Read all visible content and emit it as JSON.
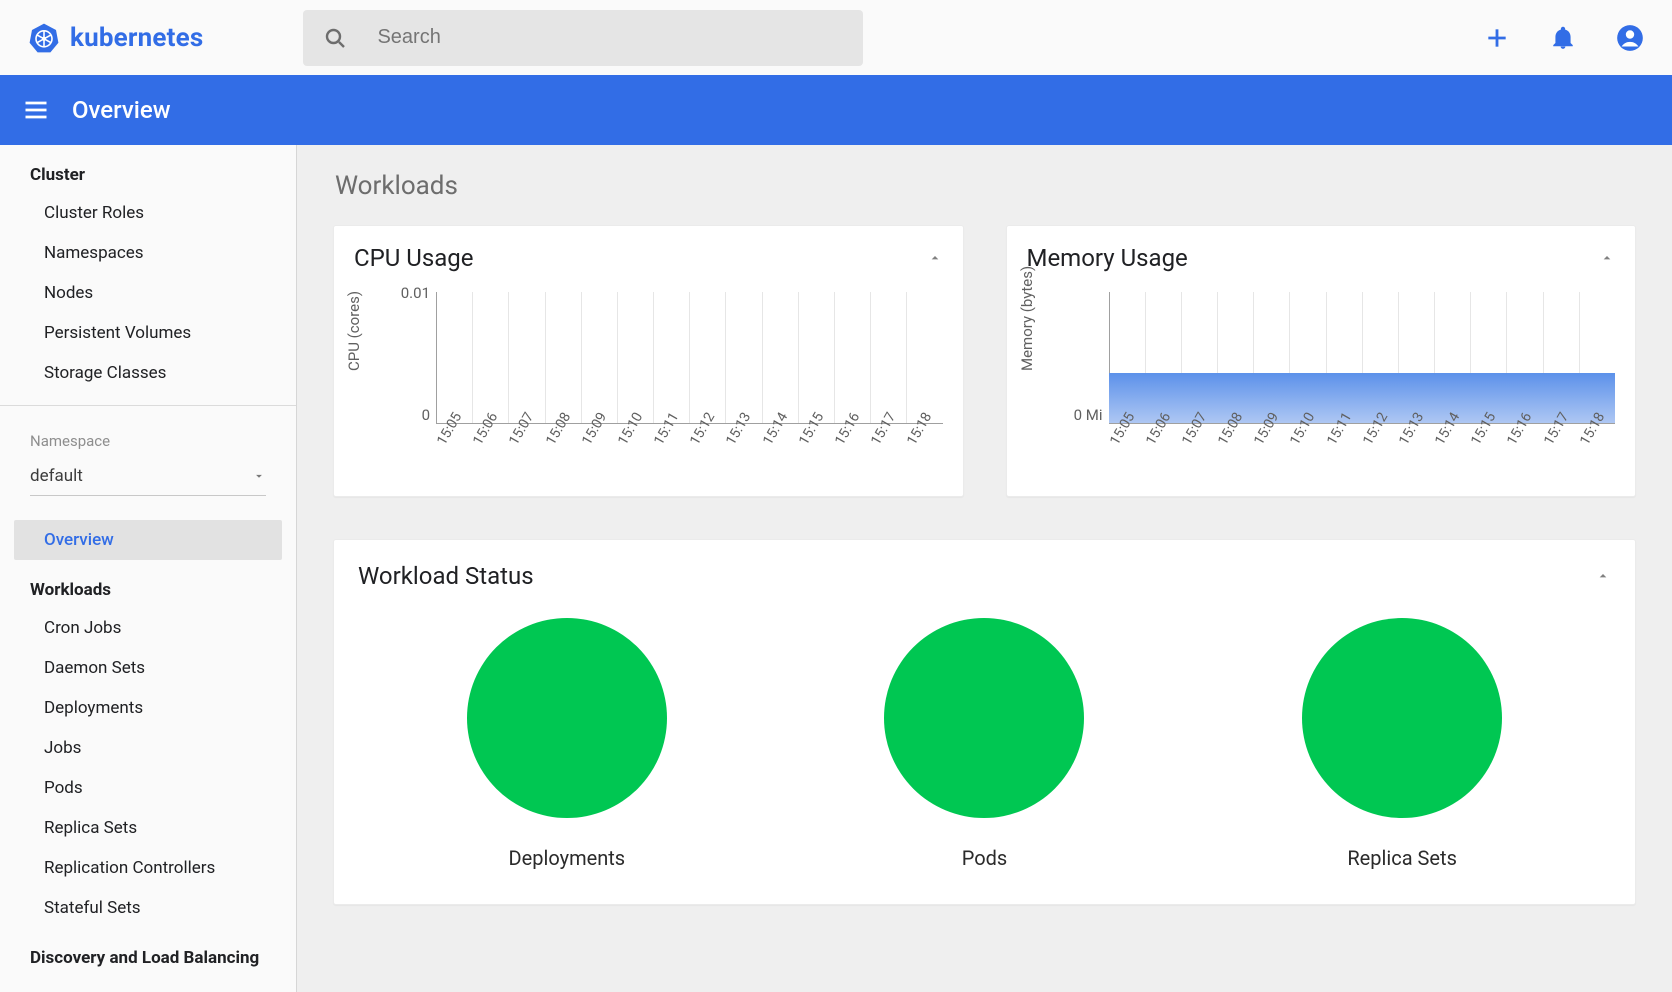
{
  "brand": {
    "name": "kubernetes"
  },
  "search": {
    "placeholder": "Search"
  },
  "toolbar": {
    "title": "Overview"
  },
  "sidebar": {
    "cluster_title": "Cluster",
    "cluster_items": [
      "Cluster Roles",
      "Namespaces",
      "Nodes",
      "Persistent Volumes",
      "Storage Classes"
    ],
    "namespace_label": "Namespace",
    "namespace_value": "default",
    "overview_label": "Overview",
    "workloads_title": "Workloads",
    "workloads_items": [
      "Cron Jobs",
      "Daemon Sets",
      "Deployments",
      "Jobs",
      "Pods",
      "Replica Sets",
      "Replication Controllers",
      "Stateful Sets"
    ],
    "dlb_title": "Discovery and Load Balancing"
  },
  "main": {
    "section_caption": "Workloads",
    "cpu_card_title": "CPU Usage",
    "mem_card_title": "Memory Usage",
    "status_card_title": "Workload Status",
    "status_items": [
      {
        "label": "Deployments",
        "ok": true
      },
      {
        "label": "Pods",
        "ok": true
      },
      {
        "label": "Replica Sets",
        "ok": true
      }
    ]
  },
  "chart_data": [
    {
      "type": "area",
      "title": "CPU Usage",
      "ylabel": "CPU (cores)",
      "ylim": [
        0,
        0.01
      ],
      "yticks": [
        0,
        0.01
      ],
      "x": [
        "15:05",
        "15:06",
        "15:07",
        "15:08",
        "15:09",
        "15:10",
        "15:11",
        "15:12",
        "15:13",
        "15:14",
        "15:15",
        "15:16",
        "15:17",
        "15:18"
      ],
      "series": [
        {
          "name": "CPU",
          "values": [
            0,
            0,
            0,
            0,
            0,
            0,
            0,
            0,
            0,
            0,
            0,
            0,
            0,
            0
          ]
        }
      ]
    },
    {
      "type": "area",
      "title": "Memory Usage",
      "ylabel": "Memory (bytes)",
      "ylim": [
        0,
        1
      ],
      "yticks_labels": [
        "0 Mi"
      ],
      "fill_fraction": 0.38,
      "x": [
        "15:05",
        "15:06",
        "15:07",
        "15:08",
        "15:09",
        "15:10",
        "15:11",
        "15:12",
        "15:13",
        "15:14",
        "15:15",
        "15:16",
        "15:17",
        "15:18"
      ],
      "series": [
        {
          "name": "Memory",
          "values": [
            0.38,
            0.38,
            0.38,
            0.38,
            0.38,
            0.38,
            0.38,
            0.38,
            0.38,
            0.38,
            0.38,
            0.38,
            0.38,
            0.38
          ]
        }
      ]
    }
  ]
}
